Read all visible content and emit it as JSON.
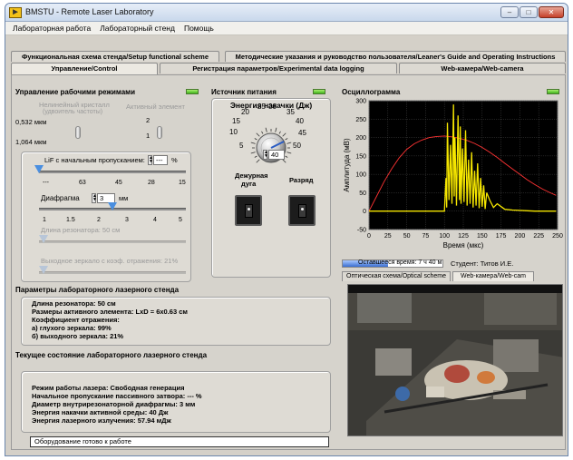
{
  "window": {
    "title": "BMSTU - Remote Laser Laboratory"
  },
  "menu": [
    "Лабораторная работа",
    "Лабораторный стенд",
    "Помощь"
  ],
  "tabs": {
    "scheme": "Функциональная схема стенда/Setup functional scheme",
    "guide": "Методические указания и руководство пользователя/Leaner's Guide and Operating Instructions",
    "control": "Управление/Control",
    "logging": "Регистрация параметров/Experimental data logging",
    "webcam": "Web-камера/Web-camera"
  },
  "modes": {
    "title": "Управление рабочими режимами",
    "crystal_label": "Нелинейный кристалл",
    "crystal_label2": "(удвоитель частоты)",
    "active_label": "Активный элемент",
    "wl1": "0,532 мкм",
    "wl2": "1,064 мкм",
    "pos2": "2",
    "pos1": "1"
  },
  "lif": {
    "label": "LiF с начальным пропусканием:",
    "value": "---",
    "unit": "%",
    "ticks": [
      "---",
      "63",
      "45",
      "28",
      "15"
    ],
    "level_pct": 0
  },
  "diaphragm": {
    "label": "Диафрагма",
    "value": "3",
    "unit": "мм",
    "ticks": [
      "1",
      "1.5",
      "2",
      "3",
      "4",
      "5"
    ],
    "level_pct": 50
  },
  "resonator_len": {
    "label": "Длина резонатора: 50 см"
  },
  "output_mirror": {
    "label": "Выходное зеркало с коэф. отражения: 21%"
  },
  "power": {
    "title": "Источник питания",
    "energy_title": "Энергия накачки (Дж)",
    "ticks": [
      "5",
      "10",
      "15",
      "20",
      "25",
      "30",
      "35",
      "40",
      "45",
      "50"
    ],
    "value": "40",
    "standby_l1": "Дежурная",
    "standby_l2": "дуга",
    "discharge": "Разряд"
  },
  "params": {
    "title": "Параметры лабораторного лазерного стенда",
    "lines": [
      "Длина резонатора: 50 см",
      "Размеры активного элемента: LxD = 6x0.63 см",
      "Коэффициент отражения:",
      "а) глухого зеркала: 99%",
      "б) выходного зеркала: 21%"
    ]
  },
  "state": {
    "title": "Текущее состояние лабораторного лазерного стенда",
    "lines": [
      "Режим работы лазера: Свободная генерация",
      "Начальное пропускание пассивного затвора: --- %",
      "Диаметр внутрирезонаторной диафрагмы: 3 мм",
      "Энергия накачки активной среды: 40 Дж",
      "Энергия лазерного излучения: 57.94 мДж"
    ]
  },
  "status": "Оборудование готово к работе",
  "scope": {
    "title": "Осциллограмма",
    "remaining": "Оставшееся время: 7 ч 40 м",
    "remaining_pct": 45,
    "student": "Студент: Титов И.Е.",
    "subtab_scheme": "Оптическая схема/Optical scheme",
    "subtab_webcam": "Web-камера/Web-cam"
  },
  "chart_data": {
    "type": "line",
    "title": "",
    "xlabel": "Время (мкс)",
    "ylabel": "Амплитуда (мВ)",
    "xlim": [
      0,
      250
    ],
    "ylim": [
      -50,
      300
    ],
    "xticks": [
      0,
      25,
      50,
      75,
      100,
      125,
      150,
      175,
      200,
      225,
      250
    ],
    "yticks": [
      -50,
      0,
      50,
      100,
      150,
      200,
      250,
      300
    ],
    "grid": true,
    "background": "#000000",
    "series": [
      {
        "color": "#ff3333",
        "x": [
          0,
          10,
          20,
          30,
          40,
          50,
          60,
          70,
          80,
          90,
          100,
          110,
          120,
          130,
          140,
          150,
          160,
          170,
          180,
          190,
          200,
          210,
          220,
          230,
          240,
          248
        ],
        "y": [
          0,
          40,
          80,
          115,
          145,
          168,
          183,
          193,
          200,
          203,
          204,
          202,
          198,
          192,
          184,
          173,
          160,
          146,
          130,
          115,
          100,
          85,
          72,
          60,
          50,
          43
        ]
      },
      {
        "color": "#f5e600",
        "x": [
          0,
          100,
          102,
          103,
          104,
          106,
          108,
          110,
          112,
          113,
          114,
          116,
          118,
          120,
          121,
          122,
          124,
          126,
          128,
          130,
          132,
          134,
          136,
          138,
          140,
          142,
          144,
          146,
          148,
          150,
          152,
          154,
          156,
          160,
          165,
          170,
          180,
          190,
          200,
          210,
          220,
          230,
          248
        ],
        "y": [
          0,
          0,
          90,
          10,
          240,
          30,
          180,
          20,
          290,
          40,
          200,
          15,
          260,
          30,
          230,
          20,
          170,
          25,
          220,
          15,
          140,
          20,
          160,
          10,
          110,
          15,
          130,
          8,
          90,
          12,
          70,
          6,
          50,
          30,
          10,
          20,
          5,
          3,
          2,
          1,
          0,
          0,
          0
        ]
      }
    ]
  }
}
